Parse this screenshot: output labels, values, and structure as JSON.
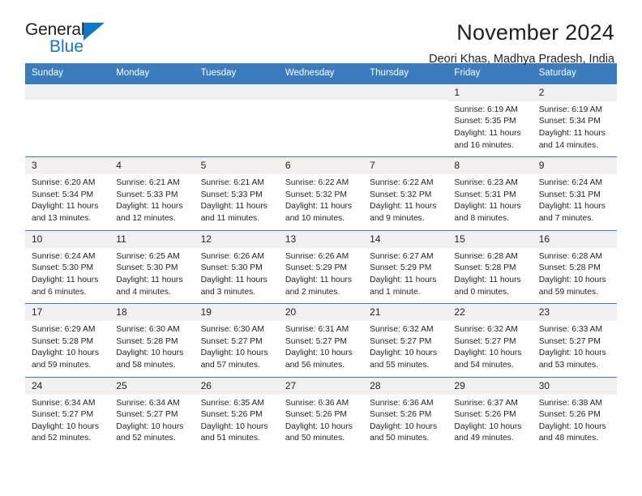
{
  "brand": {
    "name_part1": "General",
    "name_part2": "Blue",
    "triangle_color": "#1277c4",
    "text_color": "#231f20"
  },
  "header": {
    "title": "November 2024",
    "subtitle": "Deori Khas, Madhya Pradesh, India"
  },
  "theme": {
    "header_blue": "#3b7cbe",
    "daynum_band": "#f0f0f0",
    "text": "#231f20"
  },
  "weekdays": [
    "Sunday",
    "Monday",
    "Tuesday",
    "Wednesday",
    "Thursday",
    "Friday",
    "Saturday"
  ],
  "weeks": [
    [
      {
        "empty": true,
        "day": "",
        "sunrise": "",
        "sunset": "",
        "daylight_line1": "",
        "daylight_line2": ""
      },
      {
        "empty": true,
        "day": "",
        "sunrise": "",
        "sunset": "",
        "daylight_line1": "",
        "daylight_line2": ""
      },
      {
        "empty": true,
        "day": "",
        "sunrise": "",
        "sunset": "",
        "daylight_line1": "",
        "daylight_line2": ""
      },
      {
        "empty": true,
        "day": "",
        "sunrise": "",
        "sunset": "",
        "daylight_line1": "",
        "daylight_line2": ""
      },
      {
        "empty": true,
        "day": "",
        "sunrise": "",
        "sunset": "",
        "daylight_line1": "",
        "daylight_line2": ""
      },
      {
        "empty": false,
        "day": "1",
        "sunrise": "Sunrise: 6:19 AM",
        "sunset": "Sunset: 5:35 PM",
        "daylight_line1": "Daylight: 11 hours",
        "daylight_line2": "and 16 minutes."
      },
      {
        "empty": false,
        "day": "2",
        "sunrise": "Sunrise: 6:19 AM",
        "sunset": "Sunset: 5:34 PM",
        "daylight_line1": "Daylight: 11 hours",
        "daylight_line2": "and 14 minutes."
      }
    ],
    [
      {
        "empty": false,
        "day": "3",
        "sunrise": "Sunrise: 6:20 AM",
        "sunset": "Sunset: 5:34 PM",
        "daylight_line1": "Daylight: 11 hours",
        "daylight_line2": "and 13 minutes."
      },
      {
        "empty": false,
        "day": "4",
        "sunrise": "Sunrise: 6:21 AM",
        "sunset": "Sunset: 5:33 PM",
        "daylight_line1": "Daylight: 11 hours",
        "daylight_line2": "and 12 minutes."
      },
      {
        "empty": false,
        "day": "5",
        "sunrise": "Sunrise: 6:21 AM",
        "sunset": "Sunset: 5:33 PM",
        "daylight_line1": "Daylight: 11 hours",
        "daylight_line2": "and 11 minutes."
      },
      {
        "empty": false,
        "day": "6",
        "sunrise": "Sunrise: 6:22 AM",
        "sunset": "Sunset: 5:32 PM",
        "daylight_line1": "Daylight: 11 hours",
        "daylight_line2": "and 10 minutes."
      },
      {
        "empty": false,
        "day": "7",
        "sunrise": "Sunrise: 6:22 AM",
        "sunset": "Sunset: 5:32 PM",
        "daylight_line1": "Daylight: 11 hours",
        "daylight_line2": "and 9 minutes."
      },
      {
        "empty": false,
        "day": "8",
        "sunrise": "Sunrise: 6:23 AM",
        "sunset": "Sunset: 5:31 PM",
        "daylight_line1": "Daylight: 11 hours",
        "daylight_line2": "and 8 minutes."
      },
      {
        "empty": false,
        "day": "9",
        "sunrise": "Sunrise: 6:24 AM",
        "sunset": "Sunset: 5:31 PM",
        "daylight_line1": "Daylight: 11 hours",
        "daylight_line2": "and 7 minutes."
      }
    ],
    [
      {
        "empty": false,
        "day": "10",
        "sunrise": "Sunrise: 6:24 AM",
        "sunset": "Sunset: 5:30 PM",
        "daylight_line1": "Daylight: 11 hours",
        "daylight_line2": "and 6 minutes."
      },
      {
        "empty": false,
        "day": "11",
        "sunrise": "Sunrise: 6:25 AM",
        "sunset": "Sunset: 5:30 PM",
        "daylight_line1": "Daylight: 11 hours",
        "daylight_line2": "and 4 minutes."
      },
      {
        "empty": false,
        "day": "12",
        "sunrise": "Sunrise: 6:26 AM",
        "sunset": "Sunset: 5:30 PM",
        "daylight_line1": "Daylight: 11 hours",
        "daylight_line2": "and 3 minutes."
      },
      {
        "empty": false,
        "day": "13",
        "sunrise": "Sunrise: 6:26 AM",
        "sunset": "Sunset: 5:29 PM",
        "daylight_line1": "Daylight: 11 hours",
        "daylight_line2": "and 2 minutes."
      },
      {
        "empty": false,
        "day": "14",
        "sunrise": "Sunrise: 6:27 AM",
        "sunset": "Sunset: 5:29 PM",
        "daylight_line1": "Daylight: 11 hours",
        "daylight_line2": "and 1 minute."
      },
      {
        "empty": false,
        "day": "15",
        "sunrise": "Sunrise: 6:28 AM",
        "sunset": "Sunset: 5:28 PM",
        "daylight_line1": "Daylight: 11 hours",
        "daylight_line2": "and 0 minutes."
      },
      {
        "empty": false,
        "day": "16",
        "sunrise": "Sunrise: 6:28 AM",
        "sunset": "Sunset: 5:28 PM",
        "daylight_line1": "Daylight: 10 hours",
        "daylight_line2": "and 59 minutes."
      }
    ],
    [
      {
        "empty": false,
        "day": "17",
        "sunrise": "Sunrise: 6:29 AM",
        "sunset": "Sunset: 5:28 PM",
        "daylight_line1": "Daylight: 10 hours",
        "daylight_line2": "and 59 minutes."
      },
      {
        "empty": false,
        "day": "18",
        "sunrise": "Sunrise: 6:30 AM",
        "sunset": "Sunset: 5:28 PM",
        "daylight_line1": "Daylight: 10 hours",
        "daylight_line2": "and 58 minutes."
      },
      {
        "empty": false,
        "day": "19",
        "sunrise": "Sunrise: 6:30 AM",
        "sunset": "Sunset: 5:27 PM",
        "daylight_line1": "Daylight: 10 hours",
        "daylight_line2": "and 57 minutes."
      },
      {
        "empty": false,
        "day": "20",
        "sunrise": "Sunrise: 6:31 AM",
        "sunset": "Sunset: 5:27 PM",
        "daylight_line1": "Daylight: 10 hours",
        "daylight_line2": "and 56 minutes."
      },
      {
        "empty": false,
        "day": "21",
        "sunrise": "Sunrise: 6:32 AM",
        "sunset": "Sunset: 5:27 PM",
        "daylight_line1": "Daylight: 10 hours",
        "daylight_line2": "and 55 minutes."
      },
      {
        "empty": false,
        "day": "22",
        "sunrise": "Sunrise: 6:32 AM",
        "sunset": "Sunset: 5:27 PM",
        "daylight_line1": "Daylight: 10 hours",
        "daylight_line2": "and 54 minutes."
      },
      {
        "empty": false,
        "day": "23",
        "sunrise": "Sunrise: 6:33 AM",
        "sunset": "Sunset: 5:27 PM",
        "daylight_line1": "Daylight: 10 hours",
        "daylight_line2": "and 53 minutes."
      }
    ],
    [
      {
        "empty": false,
        "day": "24",
        "sunrise": "Sunrise: 6:34 AM",
        "sunset": "Sunset: 5:27 PM",
        "daylight_line1": "Daylight: 10 hours",
        "daylight_line2": "and 52 minutes."
      },
      {
        "empty": false,
        "day": "25",
        "sunrise": "Sunrise: 6:34 AM",
        "sunset": "Sunset: 5:27 PM",
        "daylight_line1": "Daylight: 10 hours",
        "daylight_line2": "and 52 minutes."
      },
      {
        "empty": false,
        "day": "26",
        "sunrise": "Sunrise: 6:35 AM",
        "sunset": "Sunset: 5:26 PM",
        "daylight_line1": "Daylight: 10 hours",
        "daylight_line2": "and 51 minutes."
      },
      {
        "empty": false,
        "day": "27",
        "sunrise": "Sunrise: 6:36 AM",
        "sunset": "Sunset: 5:26 PM",
        "daylight_line1": "Daylight: 10 hours",
        "daylight_line2": "and 50 minutes."
      },
      {
        "empty": false,
        "day": "28",
        "sunrise": "Sunrise: 6:36 AM",
        "sunset": "Sunset: 5:26 PM",
        "daylight_line1": "Daylight: 10 hours",
        "daylight_line2": "and 50 minutes."
      },
      {
        "empty": false,
        "day": "29",
        "sunrise": "Sunrise: 6:37 AM",
        "sunset": "Sunset: 5:26 PM",
        "daylight_line1": "Daylight: 10 hours",
        "daylight_line2": "and 49 minutes."
      },
      {
        "empty": false,
        "day": "30",
        "sunrise": "Sunrise: 6:38 AM",
        "sunset": "Sunset: 5:26 PM",
        "daylight_line1": "Daylight: 10 hours",
        "daylight_line2": "and 48 minutes."
      }
    ]
  ]
}
